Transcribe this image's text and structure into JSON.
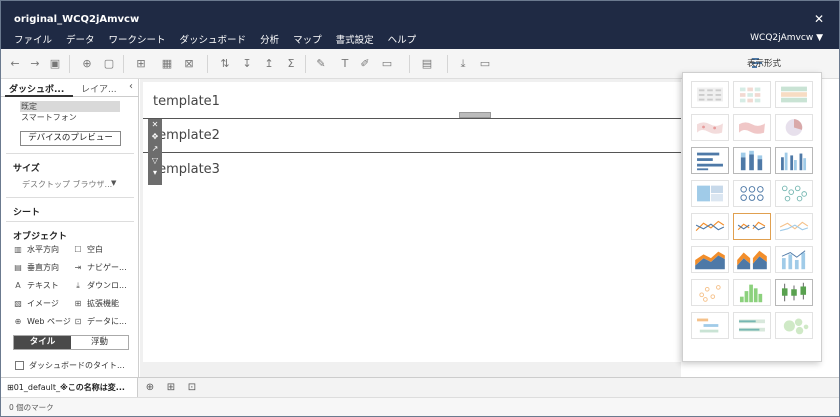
{
  "window": {
    "title": "original_WCQ2jAmvcw",
    "close_label": "✕",
    "user_label": "WCQ2jAmvcw ▼"
  },
  "menu": [
    "ファイル",
    "データ",
    "ワークシート",
    "ダッシュボード",
    "分析",
    "マップ",
    "書式設定",
    "ヘルプ"
  ],
  "toolbar": {
    "show_me_label": "表示形式"
  },
  "side": {
    "tab_dashboard": "ダッシュボ...",
    "tab_layout": "レイア...",
    "devices": [
      "既定",
      "スマートフォン"
    ],
    "device_preview_button": "デバイスのプレビュー",
    "size_header": "サイズ",
    "size_value": "デスクトップ ブラウザ...",
    "sheet_header": "シート",
    "objects_header": "オブジェクト",
    "objects": [
      {
        "icon": "▥",
        "label": "水平方向"
      },
      {
        "icon": "☐",
        "label": "空白"
      },
      {
        "icon": "▤",
        "label": "垂直方向"
      },
      {
        "icon": "⇥",
        "label": "ナビゲー..."
      },
      {
        "icon": "A",
        "label": "テキスト"
      },
      {
        "icon": "⤓",
        "label": "ダウンロ..."
      },
      {
        "icon": "▧",
        "label": "イメージ"
      },
      {
        "icon": "⊞",
        "label": "拡張機能"
      },
      {
        "icon": "⊕",
        "label": "Web ページ"
      },
      {
        "icon": "⊡",
        "label": "データに..."
      }
    ],
    "toggle_tiled": "タイル",
    "toggle_floating": "浮動",
    "show_title_label": "ダッシュボードのタイト..."
  },
  "canvas": {
    "templates": [
      "template1",
      "template2",
      "template3"
    ]
  },
  "bottom": {
    "sheet_prefix": "01_default_",
    "sheet_bold": "※この名称は変..."
  },
  "status": {
    "marks": "0 個のマーク"
  },
  "colors": {
    "titlebar": "#1f2a44",
    "blue": "#4e79a7",
    "orange": "#f28e2b",
    "teal": "#76b7b2",
    "green": "#59a14f",
    "red": "#e15759"
  }
}
